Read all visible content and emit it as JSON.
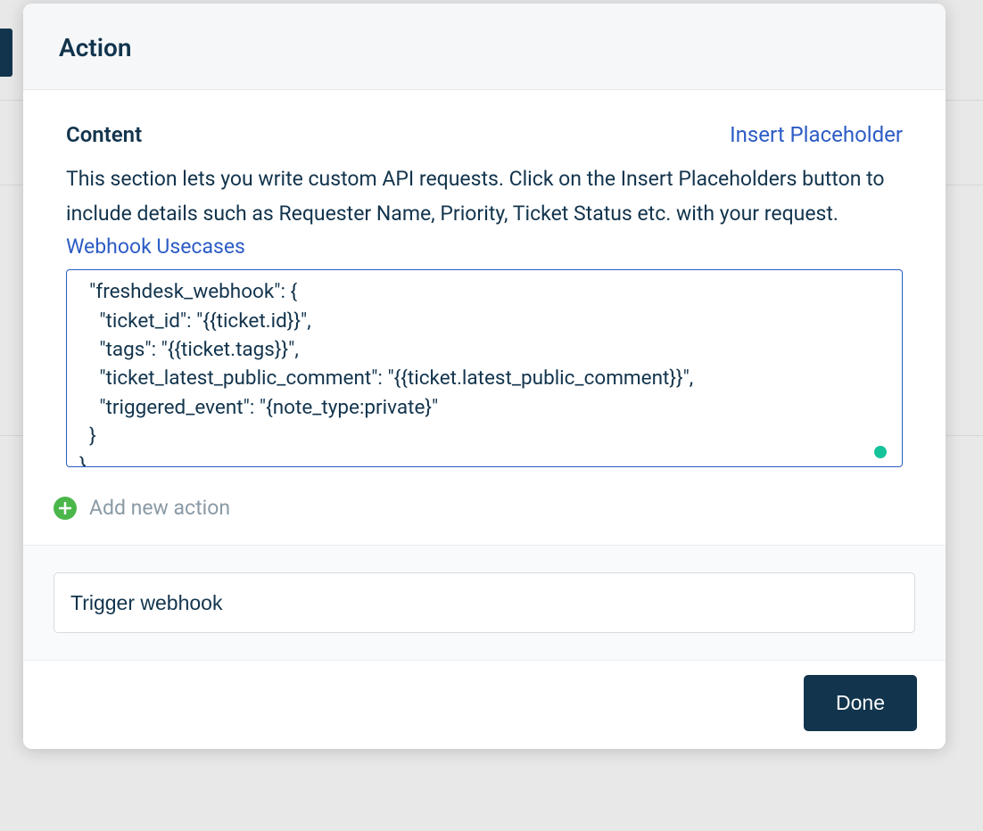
{
  "modal": {
    "title": "Action",
    "content_label": "Content",
    "insert_placeholder_label": "Insert Placeholder",
    "description": "This section lets you write custom API requests. Click on the Insert Placeholders button to include details such as Requester Name, Priority, Ticket Status etc. with your request.",
    "webhook_usecases_label": "Webhook Usecases",
    "code_content": "  \"freshdesk_webhook\": {\n    \"ticket_id\": \"{{ticket.id}}\",\n    \"tags\": \"{{ticket.tags}}\",\n    \"ticket_latest_public_comment\": \"{{ticket.latest_public_comment}}\",\n    \"triggered_event\": \"{note_type:private}\"\n  }\n}",
    "add_action_label": "Add new action",
    "trigger_value": "Trigger webhook",
    "done_label": "Done"
  }
}
